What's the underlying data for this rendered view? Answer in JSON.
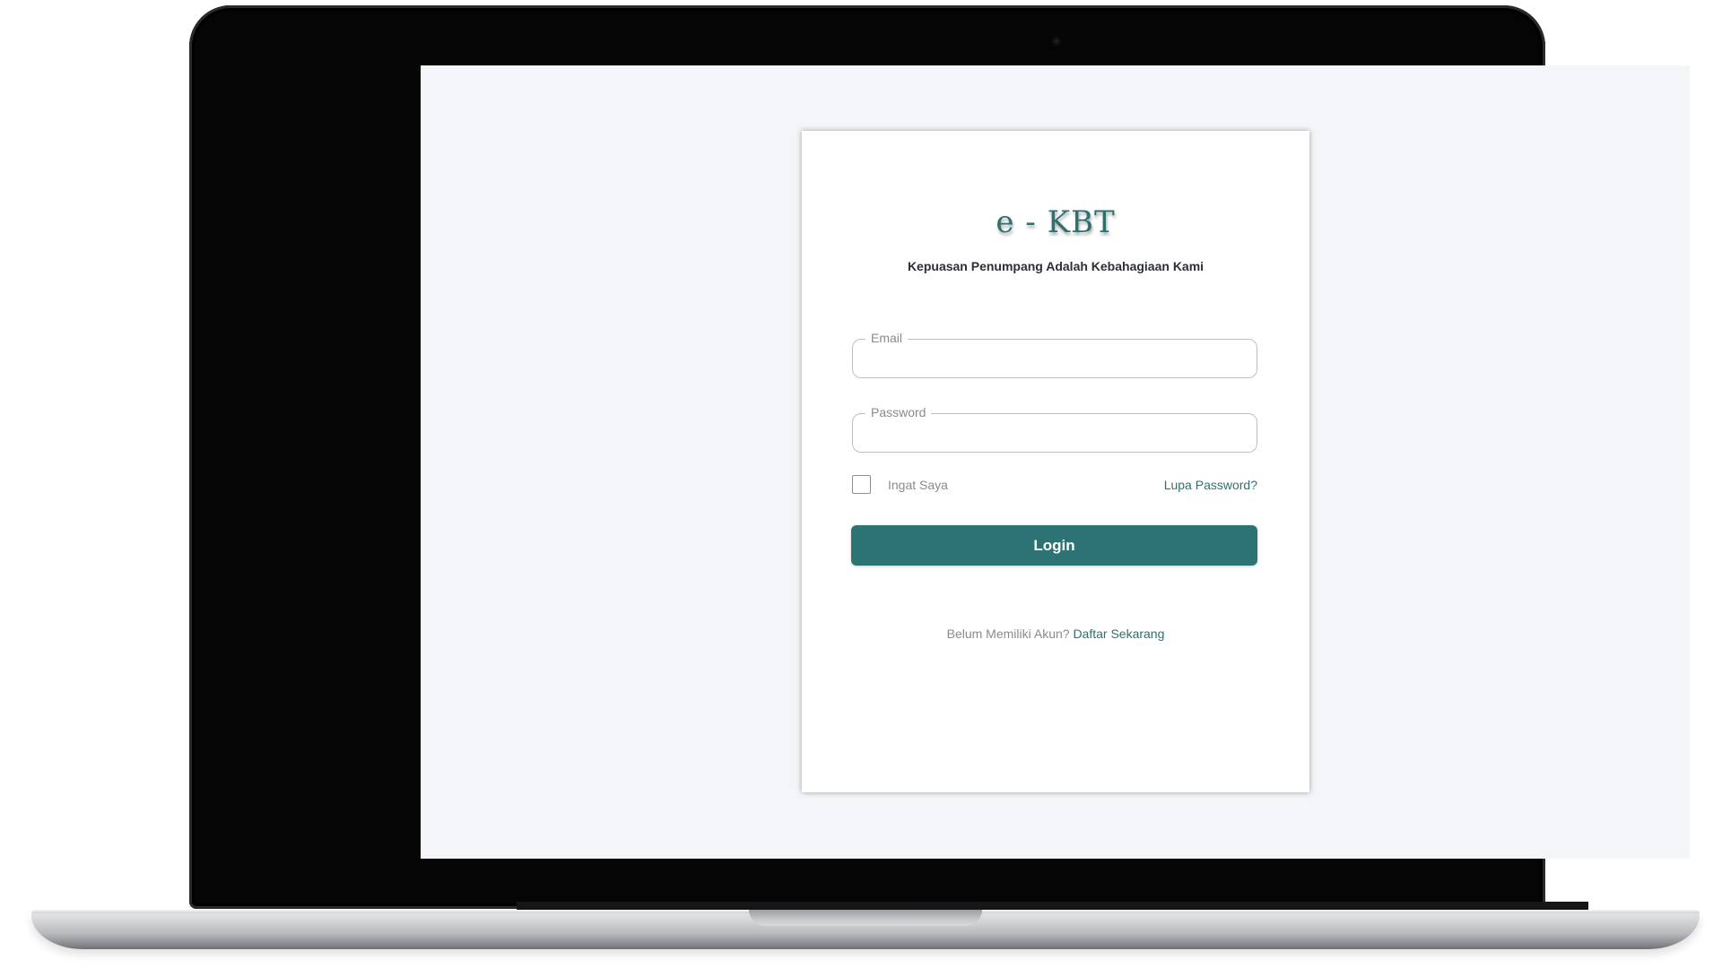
{
  "login": {
    "brand": "e - KBT",
    "tagline": "Kepuasan Penumpang Adalah Kebahagiaan Kami",
    "email": {
      "label": "Email",
      "value": "",
      "placeholder": ""
    },
    "password": {
      "label": "Password",
      "value": "",
      "placeholder": ""
    },
    "remember_label": "Ingat Saya",
    "remember_checked": false,
    "forgot_link": "Lupa Password?",
    "login_button": "Login",
    "register_prompt": "Belum Memiliki Akun?",
    "register_link": "Daftar Sekarang"
  },
  "colors": {
    "accent": "#2e7373",
    "page_background": "#f4f5f9",
    "card_background": "#ffffff",
    "text_dark": "#2c2f3a",
    "text_muted": "#8a8a8a"
  }
}
